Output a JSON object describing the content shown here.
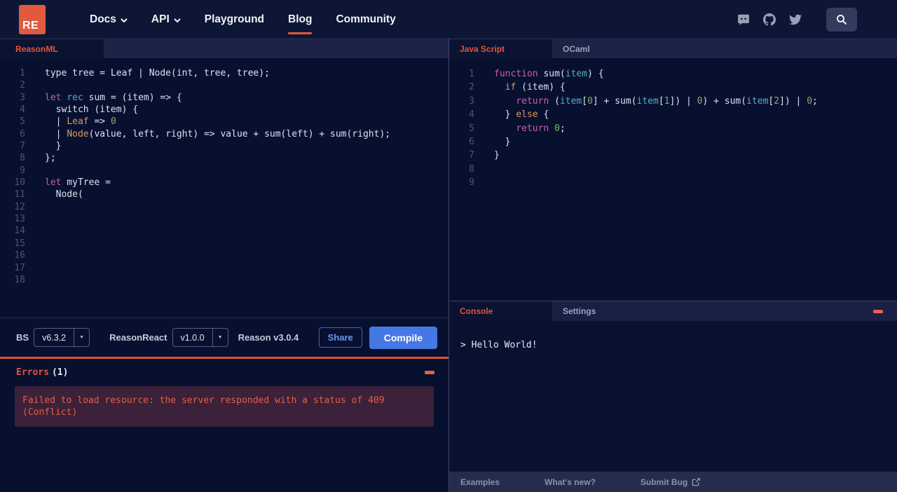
{
  "nav": {
    "logo_text": "RE",
    "items": [
      {
        "label": "Docs",
        "has_chevron": true
      },
      {
        "label": "API",
        "has_chevron": true
      },
      {
        "label": "Playground",
        "has_chevron": false
      },
      {
        "label": "Blog",
        "has_chevron": false,
        "active": true
      },
      {
        "label": "Community",
        "has_chevron": false
      }
    ],
    "icons": [
      "discord-icon",
      "github-icon",
      "twitter-icon",
      "search-icon"
    ]
  },
  "left": {
    "tab_label": "ReasonML",
    "code": [
      [
        [
          "w",
          "type tree = Leaf | Node(int, tree, tree);"
        ]
      ],
      [],
      [
        [
          "p",
          "let"
        ],
        [
          "w",
          " "
        ],
        [
          "t",
          "rec"
        ],
        [
          "w",
          " sum = (item) => {"
        ]
      ],
      [
        [
          "w",
          "  switch (item) {"
        ]
      ],
      [
        [
          "w",
          "  | "
        ],
        [
          "o",
          "Leaf"
        ],
        [
          "w",
          " => "
        ],
        [
          "g",
          "0"
        ]
      ],
      [
        [
          "w",
          "  | "
        ],
        [
          "o",
          "Node"
        ],
        [
          "w",
          "(value, left, right) => value + sum(left) + sum(right);"
        ]
      ],
      [
        [
          "w",
          "  }"
        ]
      ],
      [
        [
          "w",
          "};"
        ]
      ],
      [],
      [
        [
          "p",
          "let"
        ],
        [
          "w",
          " myTree ="
        ]
      ],
      [
        [
          "w",
          "  Node("
        ]
      ],
      [],
      [],
      [],
      [],
      [],
      [],
      []
    ],
    "toolbar": {
      "bs_label": "BS",
      "bs_version": "v6.3.2",
      "reasonreact_label": "ReasonReact",
      "reasonreact_version": "v1.0.0",
      "reason_version": "Reason v3.0.4",
      "share_label": "Share",
      "compile_label": "Compile"
    },
    "errors": {
      "title": "Errors",
      "count": "(1)",
      "message": "Failed to load resource: the server responded with a status of 409 (Conflict)"
    }
  },
  "right": {
    "tabs": [
      "Java Script",
      "OCaml"
    ],
    "code": [
      [
        [
          "p",
          "function"
        ],
        [
          "w",
          " sum("
        ],
        [
          "t",
          "item"
        ],
        [
          "w",
          ") {"
        ]
      ],
      [
        [
          "w",
          "  "
        ],
        [
          "o",
          "if"
        ],
        [
          "w",
          " (item) {"
        ]
      ],
      [
        [
          "w",
          "    "
        ],
        [
          "p",
          "return"
        ],
        [
          "w",
          " ("
        ],
        [
          "t",
          "item"
        ],
        [
          "w",
          "["
        ],
        [
          "g",
          "0"
        ],
        [
          "w",
          "] + sum("
        ],
        [
          "t",
          "item"
        ],
        [
          "w",
          "["
        ],
        [
          "g",
          "1"
        ],
        [
          "w",
          "]) | "
        ],
        [
          "g",
          "0"
        ],
        [
          "w",
          ") + sum("
        ],
        [
          "t",
          "item"
        ],
        [
          "w",
          "["
        ],
        [
          "g",
          "2"
        ],
        [
          "w",
          "]) | "
        ],
        [
          "g",
          "0"
        ],
        [
          "w",
          ";"
        ]
      ],
      [
        [
          "w",
          "  } "
        ],
        [
          "o",
          "else"
        ],
        [
          "w",
          " {"
        ]
      ],
      [
        [
          "w",
          "    "
        ],
        [
          "p",
          "return"
        ],
        [
          "w",
          " "
        ],
        [
          "g",
          "0"
        ],
        [
          "w",
          ";"
        ]
      ],
      [
        [
          "w",
          "  }"
        ]
      ],
      [
        [
          "w",
          "}"
        ]
      ],
      [],
      []
    ],
    "console": {
      "tabs": [
        "Console",
        "Settings"
      ],
      "output": "> Hello World!"
    },
    "footer": [
      "Examples",
      "What's new?",
      "Submit Bug"
    ]
  },
  "colors": {
    "accent_orange": "#E2563A",
    "logo_orange": "#E05B3D",
    "compile_button_blue": "#4478E4",
    "share_text_blue": "#6B96F0",
    "error_text": "#E4604A",
    "error_box_bg": "#3B2139",
    "syntax_keyword_pink": "#C75FA8",
    "syntax_teal": "#52AEC6",
    "syntax_orange": "#DC9A5C",
    "syntax_green": "#87AE66"
  }
}
